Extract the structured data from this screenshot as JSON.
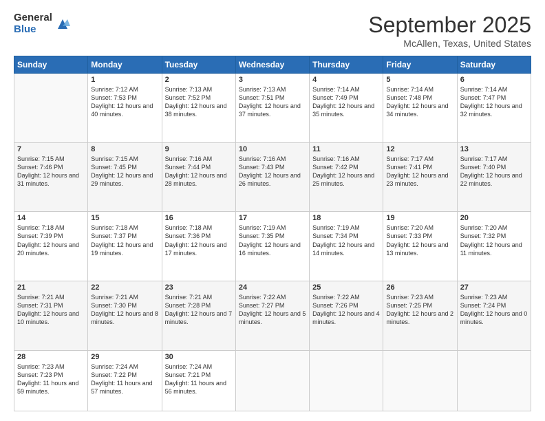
{
  "logo": {
    "general": "General",
    "blue": "Blue"
  },
  "header": {
    "month": "September 2025",
    "location": "McAllen, Texas, United States"
  },
  "weekdays": [
    "Sunday",
    "Monday",
    "Tuesday",
    "Wednesday",
    "Thursday",
    "Friday",
    "Saturday"
  ],
  "weeks": [
    [
      {
        "day": "",
        "sunrise": "",
        "sunset": "",
        "daylight": ""
      },
      {
        "day": "1",
        "sunrise": "Sunrise: 7:12 AM",
        "sunset": "Sunset: 7:53 PM",
        "daylight": "Daylight: 12 hours and 40 minutes."
      },
      {
        "day": "2",
        "sunrise": "Sunrise: 7:13 AM",
        "sunset": "Sunset: 7:52 PM",
        "daylight": "Daylight: 12 hours and 38 minutes."
      },
      {
        "day": "3",
        "sunrise": "Sunrise: 7:13 AM",
        "sunset": "Sunset: 7:51 PM",
        "daylight": "Daylight: 12 hours and 37 minutes."
      },
      {
        "day": "4",
        "sunrise": "Sunrise: 7:14 AM",
        "sunset": "Sunset: 7:49 PM",
        "daylight": "Daylight: 12 hours and 35 minutes."
      },
      {
        "day": "5",
        "sunrise": "Sunrise: 7:14 AM",
        "sunset": "Sunset: 7:48 PM",
        "daylight": "Daylight: 12 hours and 34 minutes."
      },
      {
        "day": "6",
        "sunrise": "Sunrise: 7:14 AM",
        "sunset": "Sunset: 7:47 PM",
        "daylight": "Daylight: 12 hours and 32 minutes."
      }
    ],
    [
      {
        "day": "7",
        "sunrise": "Sunrise: 7:15 AM",
        "sunset": "Sunset: 7:46 PM",
        "daylight": "Daylight: 12 hours and 31 minutes."
      },
      {
        "day": "8",
        "sunrise": "Sunrise: 7:15 AM",
        "sunset": "Sunset: 7:45 PM",
        "daylight": "Daylight: 12 hours and 29 minutes."
      },
      {
        "day": "9",
        "sunrise": "Sunrise: 7:16 AM",
        "sunset": "Sunset: 7:44 PM",
        "daylight": "Daylight: 12 hours and 28 minutes."
      },
      {
        "day": "10",
        "sunrise": "Sunrise: 7:16 AM",
        "sunset": "Sunset: 7:43 PM",
        "daylight": "Daylight: 12 hours and 26 minutes."
      },
      {
        "day": "11",
        "sunrise": "Sunrise: 7:16 AM",
        "sunset": "Sunset: 7:42 PM",
        "daylight": "Daylight: 12 hours and 25 minutes."
      },
      {
        "day": "12",
        "sunrise": "Sunrise: 7:17 AM",
        "sunset": "Sunset: 7:41 PM",
        "daylight": "Daylight: 12 hours and 23 minutes."
      },
      {
        "day": "13",
        "sunrise": "Sunrise: 7:17 AM",
        "sunset": "Sunset: 7:40 PM",
        "daylight": "Daylight: 12 hours and 22 minutes."
      }
    ],
    [
      {
        "day": "14",
        "sunrise": "Sunrise: 7:18 AM",
        "sunset": "Sunset: 7:39 PM",
        "daylight": "Daylight: 12 hours and 20 minutes."
      },
      {
        "day": "15",
        "sunrise": "Sunrise: 7:18 AM",
        "sunset": "Sunset: 7:37 PM",
        "daylight": "Daylight: 12 hours and 19 minutes."
      },
      {
        "day": "16",
        "sunrise": "Sunrise: 7:18 AM",
        "sunset": "Sunset: 7:36 PM",
        "daylight": "Daylight: 12 hours and 17 minutes."
      },
      {
        "day": "17",
        "sunrise": "Sunrise: 7:19 AM",
        "sunset": "Sunset: 7:35 PM",
        "daylight": "Daylight: 12 hours and 16 minutes."
      },
      {
        "day": "18",
        "sunrise": "Sunrise: 7:19 AM",
        "sunset": "Sunset: 7:34 PM",
        "daylight": "Daylight: 12 hours and 14 minutes."
      },
      {
        "day": "19",
        "sunrise": "Sunrise: 7:20 AM",
        "sunset": "Sunset: 7:33 PM",
        "daylight": "Daylight: 12 hours and 13 minutes."
      },
      {
        "day": "20",
        "sunrise": "Sunrise: 7:20 AM",
        "sunset": "Sunset: 7:32 PM",
        "daylight": "Daylight: 12 hours and 11 minutes."
      }
    ],
    [
      {
        "day": "21",
        "sunrise": "Sunrise: 7:21 AM",
        "sunset": "Sunset: 7:31 PM",
        "daylight": "Daylight: 12 hours and 10 minutes."
      },
      {
        "day": "22",
        "sunrise": "Sunrise: 7:21 AM",
        "sunset": "Sunset: 7:30 PM",
        "daylight": "Daylight: 12 hours and 8 minutes."
      },
      {
        "day": "23",
        "sunrise": "Sunrise: 7:21 AM",
        "sunset": "Sunset: 7:28 PM",
        "daylight": "Daylight: 12 hours and 7 minutes."
      },
      {
        "day": "24",
        "sunrise": "Sunrise: 7:22 AM",
        "sunset": "Sunset: 7:27 PM",
        "daylight": "Daylight: 12 hours and 5 minutes."
      },
      {
        "day": "25",
        "sunrise": "Sunrise: 7:22 AM",
        "sunset": "Sunset: 7:26 PM",
        "daylight": "Daylight: 12 hours and 4 minutes."
      },
      {
        "day": "26",
        "sunrise": "Sunrise: 7:23 AM",
        "sunset": "Sunset: 7:25 PM",
        "daylight": "Daylight: 12 hours and 2 minutes."
      },
      {
        "day": "27",
        "sunrise": "Sunrise: 7:23 AM",
        "sunset": "Sunset: 7:24 PM",
        "daylight": "Daylight: 12 hours and 0 minutes."
      }
    ],
    [
      {
        "day": "28",
        "sunrise": "Sunrise: 7:23 AM",
        "sunset": "Sunset: 7:23 PM",
        "daylight": "Daylight: 11 hours and 59 minutes."
      },
      {
        "day": "29",
        "sunrise": "Sunrise: 7:24 AM",
        "sunset": "Sunset: 7:22 PM",
        "daylight": "Daylight: 11 hours and 57 minutes."
      },
      {
        "day": "30",
        "sunrise": "Sunrise: 7:24 AM",
        "sunset": "Sunset: 7:21 PM",
        "daylight": "Daylight: 11 hours and 56 minutes."
      },
      {
        "day": "",
        "sunrise": "",
        "sunset": "",
        "daylight": ""
      },
      {
        "day": "",
        "sunrise": "",
        "sunset": "",
        "daylight": ""
      },
      {
        "day": "",
        "sunrise": "",
        "sunset": "",
        "daylight": ""
      },
      {
        "day": "",
        "sunrise": "",
        "sunset": "",
        "daylight": ""
      }
    ]
  ]
}
